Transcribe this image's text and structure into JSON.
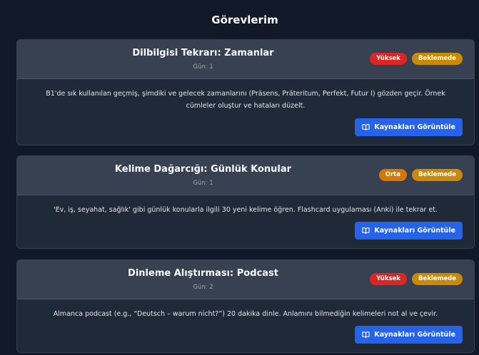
{
  "page": {
    "title": "Görevlerim"
  },
  "tasks": [
    {
      "title": "Dilbilgisi Tekrarı: Zamanlar",
      "day": "Gün: 1",
      "priority": "Yüksek",
      "status": "Beklemede",
      "description": "B1'de sık kullanılan geçmiş, şimdiki ve gelecek zamanlarını (Präsens, Präteritum, Perfekt, Futur I) gözden geçir. Örnek cümleler oluştur ve hataları düzelt.",
      "button_label": "Kaynakları Görüntüle"
    },
    {
      "title": "Kelime Dağarcığı: Günlük Konular",
      "day": "Gün: 1",
      "priority": "Orta",
      "status": "Beklemede",
      "description": "'Ev, iş, seyahat, sağlık' gibi günlük konularla ilgili 30 yeni kelime öğren. Flashcard uygulaması (Anki) ile tekrar et.",
      "button_label": "Kaynakları Görüntüle"
    },
    {
      "title": "Dinleme Alıştırması: Podcast",
      "day": "Gün: 2",
      "priority": "Yüksek",
      "status": "Beklemede",
      "description": "Almanca podcast (e.g., “Deutsch – warum nicht?”) 20 dakika dinle. Anlamını bilmediğin kelimeleri not al ve çevir.",
      "button_label": "Kaynakları Görüntüle"
    }
  ],
  "colors": {
    "background": "#111827",
    "card": "#1f2937",
    "card_header": "#374151",
    "priority_high": "#dc2626",
    "priority_medium": "#d97706",
    "status_pending": "#ca8a04",
    "button": "#2563eb"
  },
  "icons": {
    "resources_button": "book-open-icon"
  }
}
